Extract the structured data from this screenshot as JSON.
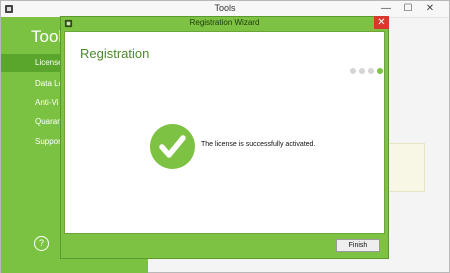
{
  "window": {
    "title": "Tools",
    "controls": {
      "minimize": "—",
      "maximize": "☐",
      "close": "✕"
    }
  },
  "sidebar": {
    "title": "Tool",
    "items": [
      {
        "label": "License",
        "active": true
      },
      {
        "label": "Data Lo",
        "active": false
      },
      {
        "label": "Anti-Vi",
        "active": false
      },
      {
        "label": "Quaran",
        "active": false
      },
      {
        "label": "Suppor",
        "active": false
      }
    ],
    "help_icon": "?"
  },
  "dialog": {
    "title": "Registration Wizard",
    "close_glyph": "✕",
    "heading": "Registration",
    "steps_total": 4,
    "current_step": 4,
    "message": "The license is successfully activated.",
    "success_icon": "check-icon",
    "finish_label": "Finish"
  },
  "colors": {
    "accent": "#7dc242",
    "sidebar_active": "#5aa52b",
    "close": "#d9382e"
  }
}
